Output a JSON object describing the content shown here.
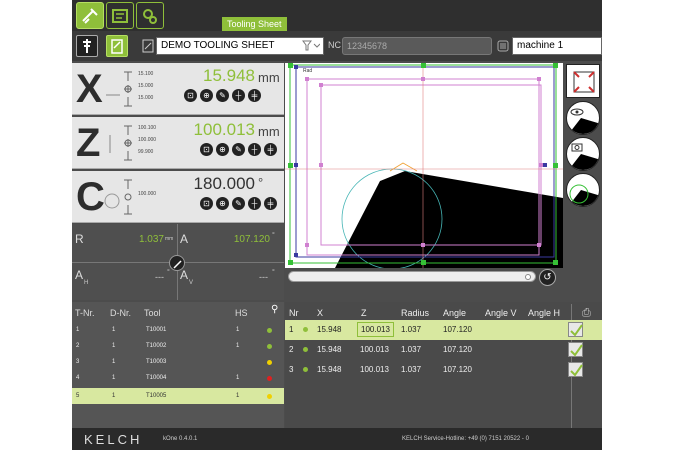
{
  "tabs": {
    "tooling_sheet": "Tooling Sheet"
  },
  "toolbar": {
    "sheet_name": "DEMO TOOLING SHEET",
    "nc_label": "NC",
    "nc_placeholder": "12345678",
    "machine": "machine 1"
  },
  "axes": {
    "x": {
      "letter": "X",
      "small": [
        "15.100",
        "15.000",
        "15.000"
      ],
      "value": "15.948",
      "unit": "mm"
    },
    "z": {
      "letter": "Z",
      "small": [
        "100.100",
        "100.000",
        "99.900"
      ],
      "value": "100.013",
      "unit": "mm"
    },
    "c": {
      "letter": "C",
      "small": [
        "100.000"
      ],
      "value": "180.000",
      "unit": "°"
    }
  },
  "measure": {
    "r_label": "R",
    "r_value": "1.037",
    "r_unit": "mm",
    "a_label": "A",
    "a_value": "107.120",
    "a_unit": "°",
    "ah_label": "A",
    "ah_sub": "H",
    "ah_value": "---",
    "ah_unit": "°",
    "av_label": "A",
    "av_sub": "V",
    "av_value": "---",
    "av_unit": "°"
  },
  "canvas": {
    "tag": "Rad"
  },
  "tools_table": {
    "headers": [
      "T-Nr.",
      "D-Nr.",
      "Tool",
      "HS"
    ],
    "rows": [
      {
        "tnr": "1",
        "dnr": "1",
        "tool": "T10001",
        "hs": "1",
        "status": "#8fbf3a"
      },
      {
        "tnr": "2",
        "dnr": "1",
        "tool": "T10002",
        "hs": "1",
        "status": "#8fbf3a"
      },
      {
        "tnr": "3",
        "dnr": "1",
        "tool": "T10003",
        "hs": "",
        "status": "#f0d000"
      },
      {
        "tnr": "4",
        "dnr": "1",
        "tool": "T10004",
        "hs": "1",
        "status": "#e02020"
      },
      {
        "tnr": "5",
        "dnr": "1",
        "tool": "T10005",
        "hs": "1",
        "status": "#f0d000"
      }
    ]
  },
  "meas_table": {
    "headers": [
      "Nr",
      "X",
      "Z",
      "Radius",
      "Angle",
      "Angle V",
      "Angle H"
    ],
    "rows": [
      {
        "nr": "1",
        "x": "15.948",
        "z": "100.013",
        "radius": "1.037",
        "angle": "107.120"
      },
      {
        "nr": "2",
        "x": "15.948",
        "z": "100.013",
        "radius": "1.037",
        "angle": "107.120"
      },
      {
        "nr": "3",
        "x": "15.948",
        "z": "100.013",
        "radius": "1.037",
        "angle": "107.120"
      }
    ]
  },
  "footer": {
    "brand": "KELCH",
    "version": "kOne   0.4.0.1",
    "hotline": "KELCH Service-Hotline: +49 (0) 7151 20522 - 0"
  },
  "colors": {
    "accent": "#8fbf3a",
    "panel": "#e6e6e6",
    "dark": "#4c4c4c"
  }
}
